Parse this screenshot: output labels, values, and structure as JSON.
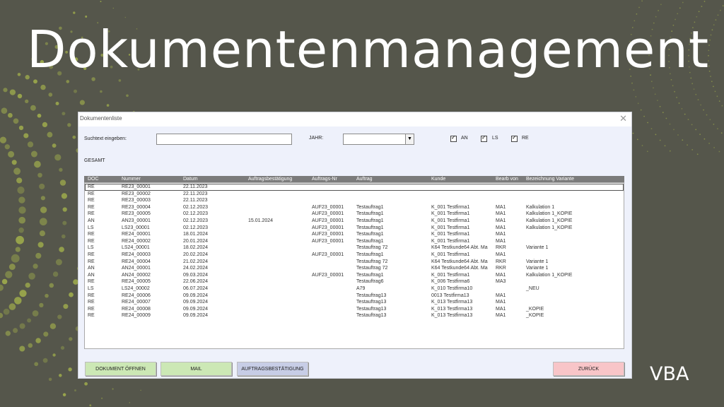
{
  "hero": {
    "title": "Dokumentenmanagement",
    "tag": "VBA"
  },
  "window": {
    "title": "Dokumentenliste",
    "close_icon": "close-icon",
    "search_label": "Suchtext eingeben:",
    "search_value": "",
    "year_label": "JAHR:",
    "year_value": "",
    "filters": [
      {
        "label": "AN",
        "checked": true
      },
      {
        "label": "LS",
        "checked": true
      },
      {
        "label": "RE",
        "checked": true
      }
    ],
    "summary_label": "GESAMT",
    "columns": [
      "DOC",
      "Nummer",
      "Datum",
      "Auftragsbestätigung",
      "Auftrags-Nr",
      "Auftrag",
      "Kunde",
      "Bearb von",
      "Bezeichnung Variante"
    ],
    "rows": [
      [
        "RE",
        "RE23_00001",
        "22.11.2023",
        "",
        "",
        "",
        "",
        "",
        ""
      ],
      [
        "RE",
        "RE23_00002",
        "22.11.2023",
        "",
        "",
        "",
        "",
        "",
        ""
      ],
      [
        "RE",
        "RE23_00003",
        "22.11.2023",
        "",
        "",
        "",
        "",
        "",
        ""
      ],
      [
        "RE",
        "RE23_00004",
        "02.12.2023",
        "",
        "AUF23_00001",
        "Testauftrag1",
        "K_001 Testfirma1",
        "MA1",
        "Kalkulation 1"
      ],
      [
        "RE",
        "RE23_00005",
        "02.12.2023",
        "",
        "AUF23_00001",
        "Testauftrag1",
        "K_001 Testfirma1",
        "MA1",
        "Kalkulation 1_KOPIE"
      ],
      [
        "AN",
        "AN23_00001",
        "02.12.2023",
        "15.01.2024",
        "AUF23_00001",
        "Testauftrag1",
        "K_001 Testfirma1",
        "MA1",
        "Kalkulation 1_KOPIE"
      ],
      [
        "LS",
        "LS23_00001",
        "02.12.2023",
        "",
        "AUF23_00001",
        "Testauftrag1",
        "K_001 Testfirma1",
        "MA1",
        "Kalkulation 1_KOPIE"
      ],
      [
        "RE",
        "RE24_00001",
        "18.01.2024",
        "",
        "AUF23_00001",
        "Testauftrag1",
        "K_001 Testfirma1",
        "MA1",
        ""
      ],
      [
        "RE",
        "RE24_00002",
        "20.01.2024",
        "",
        "AUF23_00001",
        "Testauftrag1",
        "K_001 Testfirma1",
        "MA1",
        ""
      ],
      [
        "LS",
        "LS24_00001",
        "18.02.2024",
        "",
        "",
        "Testauftrag 72",
        "K64 Testkunde64 Abt. Ma",
        "RKR",
        "Variante 1"
      ],
      [
        "RE",
        "RE24_00003",
        "20.02.2024",
        "",
        "AUF23_00001",
        "Testauftrag1",
        "K_001 Testfirma1",
        "MA1",
        ""
      ],
      [
        "RE",
        "RE24_00004",
        "21.02.2024",
        "",
        "",
        "Testauftrag 72",
        "K64 Testkunde64 Abt. Ma",
        "RKR",
        "Variante 1"
      ],
      [
        "AN",
        "AN24_00001",
        "24.02.2024",
        "",
        "",
        "Testauftrag 72",
        "K64 Testkunde64 Abt. Ma",
        "RKR",
        "Variante 1"
      ],
      [
        "AN",
        "AN24_00002",
        "09.03.2024",
        "",
        "AUF23_00001",
        "Testauftrag1",
        "K_001 Testfirma1",
        "MA1",
        "Kalkulation 1_KOPIE"
      ],
      [
        "RE",
        "RE24_00005",
        "22.06.2024",
        "",
        "",
        "Testauftrag6",
        "K_006 Testfirma6",
        "MA3",
        ""
      ],
      [
        "LS",
        "LS24_00002",
        "06.07.2024",
        "",
        "",
        "A79",
        "K_010 Testfirma10",
        "",
        "_NEU"
      ],
      [
        "RE",
        "RE24_00006",
        "09.09.2024",
        "",
        "",
        "Testauftrag13",
        "0013 Testfirma13",
        "MA1",
        ""
      ],
      [
        "RE",
        "RE24_00007",
        "09.09.2024",
        "",
        "",
        "Testauftrag13",
        "K_013 Testfirma13",
        "MA1",
        ""
      ],
      [
        "RE",
        "RE24_00008",
        "09.09.2024",
        "",
        "",
        "Testauftrag13",
        "K_013 Testfirma13",
        "MA1",
        "_KOPIE"
      ],
      [
        "RE",
        "RE24_00009",
        "09.09.2024",
        "",
        "",
        "Testauftrag13",
        "K_013 Testfirma13",
        "MA1",
        "_KOPIE"
      ]
    ],
    "buttons": {
      "open": "DOKUMENT ÖFFNEN",
      "mail": "MAIL",
      "confirm": "AUFTRAGSBESTÄTIGUNG",
      "back": "ZURÜCK"
    }
  },
  "colors": {
    "background": "#55564b",
    "dots": "#a4b24c",
    "btn_green": "#cce8b5",
    "btn_blue": "#c7cde6",
    "btn_red": "#f8c5c8",
    "header_gray": "#7b7b7b"
  }
}
